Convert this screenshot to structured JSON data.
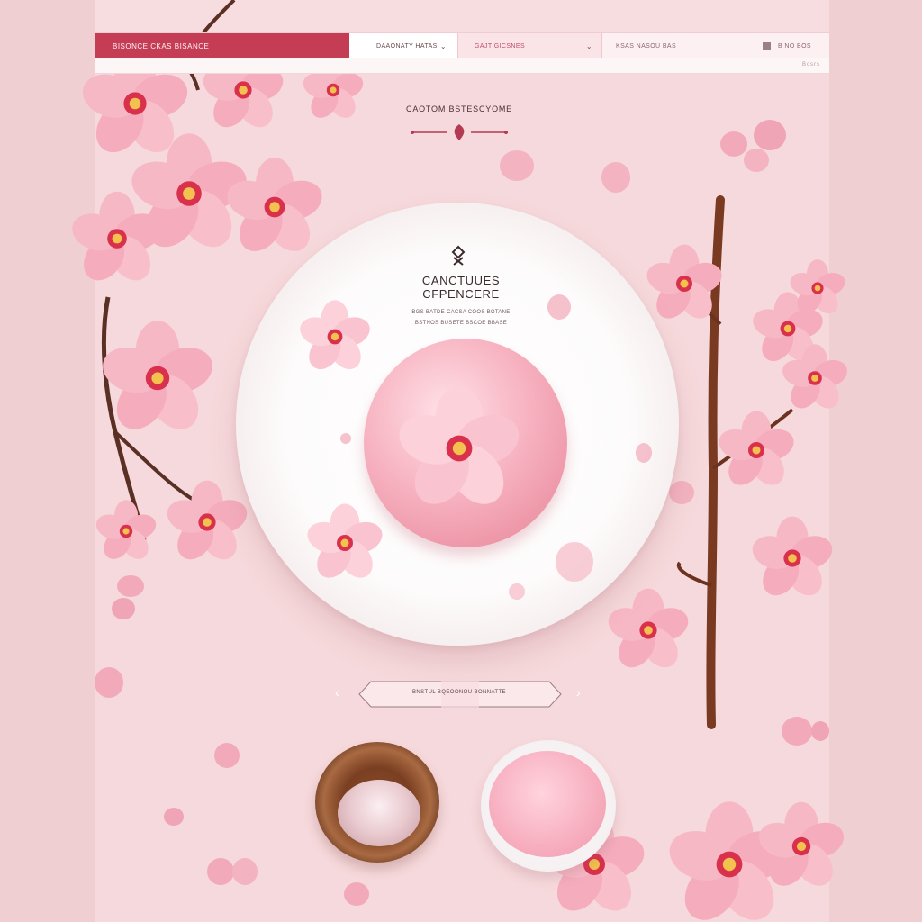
{
  "nav": {
    "brand": "Bisonce Ckas BiSance",
    "select_one": "Daaonaty Hatas",
    "select_two": "Gajt Gicsnes",
    "search": "Ksas Nasou Bas",
    "search_trail": "B No Bos"
  },
  "subbar": {
    "text": "Bcsrs"
  },
  "section": {
    "heading": "Caotom Bstescyome"
  },
  "plate": {
    "title_line1": "Canctuues",
    "title_line2": "Cfpencere",
    "sub_line1": "Bgs Batde Cacsa Coos Botane",
    "sub_line2": "Bstnos Busete Bscoe Bbase"
  },
  "carousel": {
    "label": "Bnstul Bqeoonou Bonnatte",
    "prev": "‹",
    "next": "›"
  },
  "colors": {
    "accent": "#c53c55",
    "page_bg": "#f7dde0",
    "petal": "#f5a9b8"
  },
  "icons": {
    "brand_mark": "blossom-logo-icon",
    "ornament": "divider-ornament-icon",
    "dropdown": "chevron-down-icon",
    "search": "search-icon"
  }
}
